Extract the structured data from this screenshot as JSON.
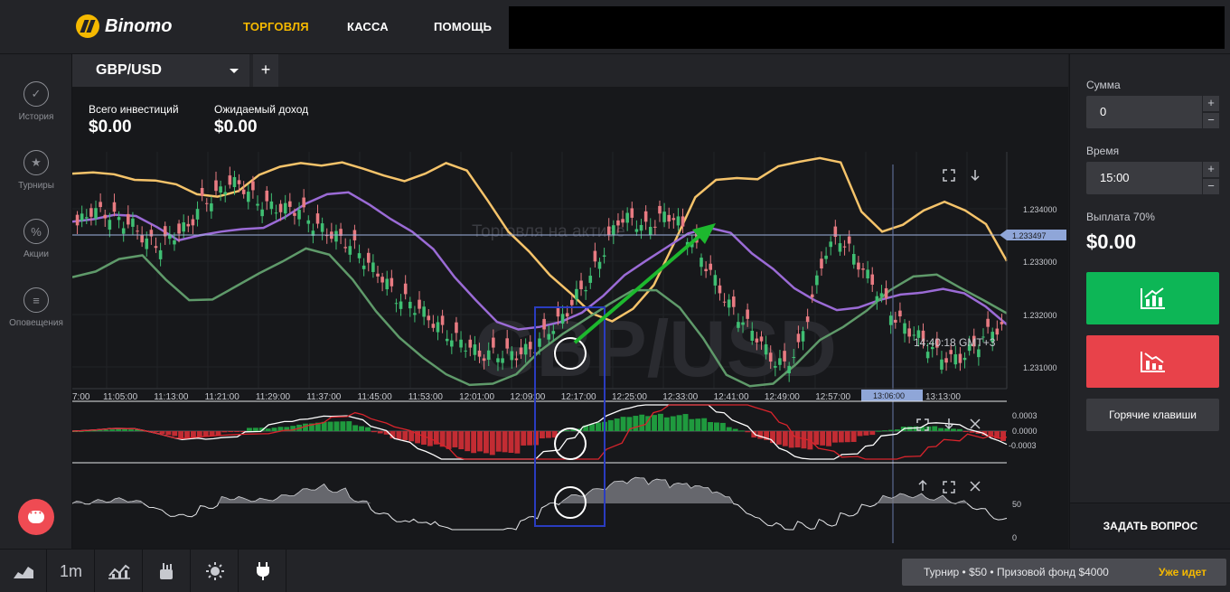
{
  "header": {
    "logo_text": "Binomo",
    "nav": [
      "ТОРГОВЛЯ",
      "КАССА",
      "ПОМОЩЬ"
    ],
    "active_nav": "ТОРГОВЛЯ",
    "brand_color": "#f5b900"
  },
  "sidebar": {
    "items": [
      {
        "label": "История",
        "icon": "check-circle-icon"
      },
      {
        "label": "Турниры",
        "icon": "trophy-icon"
      },
      {
        "label": "Акции",
        "icon": "percent-icon"
      },
      {
        "label": "Оповещения",
        "icon": "list-icon"
      }
    ],
    "chat_icon": "chat-icon"
  },
  "chart_header": {
    "pair": "GBP/USD",
    "add_label": "+"
  },
  "investments": {
    "total_label": "Всего инвестиций",
    "total_value": "$0.00",
    "expected_label": "Ожидаемый доход",
    "expected_value": "$0.00"
  },
  "chart": {
    "watermark": "GBP/USD",
    "faded_text": "Торговля на активе",
    "price_ticks": [
      "1.234000",
      "1.233000",
      "1.232000",
      "1.231000"
    ],
    "current_price": "1.233497",
    "time_ticks": [
      "7:00",
      "11:05:00",
      "11:13:00",
      "11:21:00",
      "11:29:00",
      "11:37:00",
      "11:45:00",
      "11:53:00",
      "12:01:00",
      "12:09:00",
      "12:17:00",
      "12:25:00",
      "12:33:00",
      "12:41:00",
      "12:49:00",
      "12:57:00",
      "13:13:00"
    ],
    "cursor_time": "13:06:00",
    "clock": "14:40:18 GMT+3",
    "macd_ticks": [
      "0.0003",
      "0.0000",
      "-0.0003"
    ],
    "osc_ticks": [
      "50",
      "0"
    ]
  },
  "chart_data": {
    "type": "candlestick",
    "yrange": [
      1.2305,
      1.2343
    ],
    "upper_band": [
      1.23395,
      1.23397,
      1.23394,
      1.23385,
      1.23384,
      1.23378,
      1.23362,
      1.23358,
      1.23367,
      1.23393,
      1.23406,
      1.23412,
      1.23408,
      1.23413,
      1.23403,
      1.23392,
      1.23383,
      1.23395,
      1.23412,
      1.234,
      1.23352,
      1.23302,
      1.2327,
      1.23232,
      1.23203,
      1.23171,
      1.23158,
      1.23178,
      1.23216,
      1.23285,
      1.23357,
      1.23385,
      1.23388,
      1.23386,
      1.23407,
      1.23414,
      1.2342,
      1.23413,
      1.23334,
      1.23302,
      1.23313,
      1.23336,
      1.2335,
      1.23336,
      1.23314,
      1.23255
    ],
    "middle_band": [
      1.23318,
      1.23322,
      1.23329,
      1.23327,
      1.23309,
      1.23288,
      1.23296,
      1.23302,
      1.23306,
      1.23308,
      1.23325,
      1.23347,
      1.23362,
      1.23365,
      1.23345,
      1.23322,
      1.23302,
      1.23274,
      1.23229,
      1.23192,
      1.23157,
      1.23145,
      1.23149,
      1.23157,
      1.23172,
      1.23199,
      1.23232,
      1.23255,
      1.23277,
      1.23299,
      1.23308,
      1.233,
      1.23267,
      1.23242,
      1.23211,
      1.23191,
      1.23176,
      1.2318,
      1.23192,
      1.23201,
      1.23204,
      1.2321,
      1.23203,
      1.23182,
      1.23153
    ],
    "lower_band": [
      1.23229,
      1.23238,
      1.23258,
      1.23264,
      1.23225,
      1.23192,
      1.23193,
      1.23214,
      1.23235,
      1.23254,
      1.23275,
      1.23265,
      1.23225,
      1.23174,
      1.23132,
      1.231,
      1.23073,
      1.23056,
      1.23058,
      1.23073,
      1.2311,
      1.23138,
      1.23162,
      1.23186,
      1.23208,
      1.23208,
      1.2318,
      1.23131,
      1.23072,
      1.23054,
      1.23058,
      1.2309,
      1.23128,
      1.23149,
      1.23175,
      1.23208,
      1.2323,
      1.23233,
      1.23212,
      1.23192,
      1.23171
    ],
    "candles_close": [
      1.23312,
      1.23336,
      1.23331,
      1.23321,
      1.23312,
      1.23287,
      1.2328,
      1.23298,
      1.2331,
      1.23349,
      1.2336,
      1.23382,
      1.23373,
      1.2335,
      1.23342,
      1.23338,
      1.23338,
      1.23314,
      1.23302,
      1.2329,
      1.23277,
      1.23249,
      1.23229,
      1.23197,
      1.23188,
      1.23171,
      1.2315,
      1.23133,
      1.23122,
      1.23104,
      1.23107,
      1.23105,
      1.23107,
      1.23118,
      1.23144,
      1.23164,
      1.23199,
      1.23229,
      1.23273,
      1.23321,
      1.23322,
      1.23307,
      1.23325,
      1.23327,
      1.23296,
      1.23262,
      1.23223,
      1.23184,
      1.23159,
      1.23135,
      1.23099,
      1.23087,
      1.23114,
      1.23195,
      1.23273,
      1.23292,
      1.23263,
      1.2323,
      1.23198,
      1.23163,
      1.23144,
      1.23127,
      1.23106,
      1.23097,
      1.23103,
      1.23124,
      1.23146
    ]
  },
  "trade_panel": {
    "amount_label": "Сумма",
    "amount_value": "0",
    "time_label": "Время",
    "time_value": "15:00",
    "plus": "+",
    "minus": "−",
    "payout_label": "Выплата 70%",
    "payout_value": "$0.00",
    "up_color": "#0db656",
    "down_color": "#e8424a",
    "hotkeys_label": "Горячие клавиши",
    "ask_label": "ЗАДАТЬ ВОПРОС"
  },
  "bottom": {
    "timeframe": "1m",
    "icons": [
      "area-chart-icon",
      "indicator-icon",
      "drawing-tools-icon",
      "theme-icon",
      "plugin-icon"
    ],
    "tournament_text": "Турнир • $50 • Призовой фонд $4000",
    "tournament_status": "Уже идет"
  }
}
